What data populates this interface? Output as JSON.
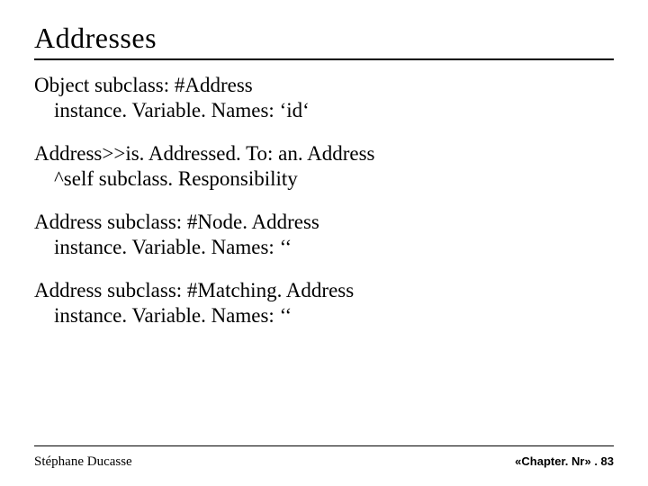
{
  "title": "Addresses",
  "blocks": [
    {
      "line1": "Object subclass: #Address",
      "line2": "instance. Variable. Names: ‘id‘"
    },
    {
      "line1": "Address>>is. Addressed. To: an. Address",
      "line2": "^self subclass. Responsibility"
    },
    {
      "line1": "Address subclass: #Node. Address",
      "line2": "instance. Variable. Names: ‘‘"
    },
    {
      "line1": "Address subclass: #Matching. Address",
      "line2": "instance. Variable. Names: ‘‘"
    }
  ],
  "footer": {
    "author": "Stéphane Ducasse",
    "page": "«Chapter. Nr» . 83"
  }
}
